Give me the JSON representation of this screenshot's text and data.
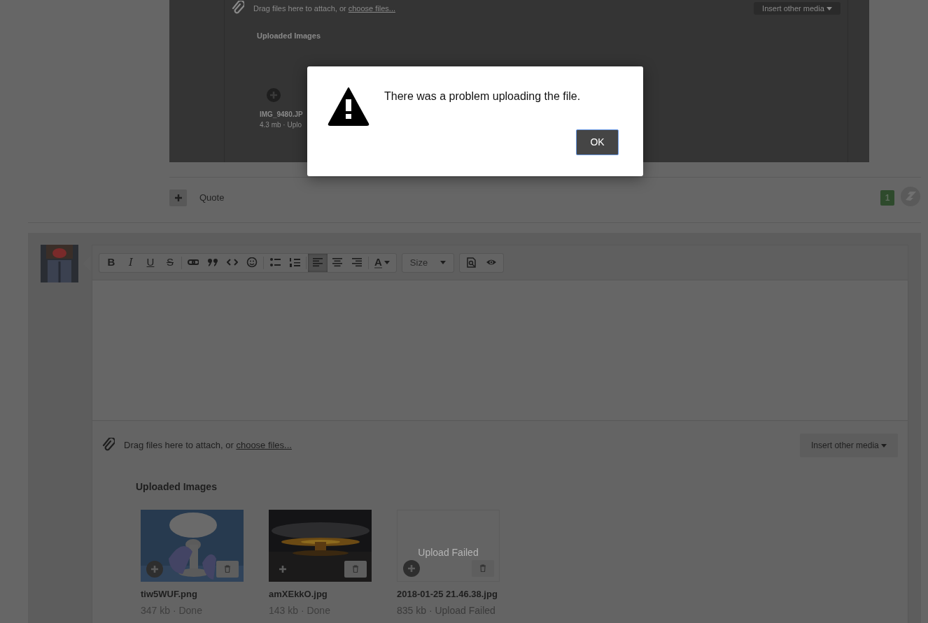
{
  "top_post": {
    "attach": {
      "hint": "Drag files here to attach, or ",
      "link": "choose files..."
    },
    "insert_button": "Insert other media",
    "heading": "Uploaded Images",
    "files": [
      {
        "name": "IMG_9480.JP",
        "meta": "4.3 mb · Uplo"
      }
    ]
  },
  "post_footer": {
    "quote_label": "Quote",
    "count": "1"
  },
  "editor": {
    "toolbar": [
      [
        {
          "kind": "bold",
          "label": "B",
          "selected": false
        },
        {
          "kind": "italic",
          "label": "I",
          "selected": false
        },
        {
          "kind": "underline",
          "label": "U",
          "selected": false
        },
        {
          "kind": "strike",
          "label": "S",
          "selected": false
        },
        {
          "kind": "sep"
        },
        {
          "kind": "link",
          "selected": false
        },
        {
          "kind": "quote",
          "selected": false
        },
        {
          "kind": "code",
          "selected": false
        },
        {
          "kind": "smilie",
          "selected": false
        },
        {
          "kind": "sep"
        },
        {
          "kind": "bullets",
          "selected": false
        },
        {
          "kind": "numbers",
          "selected": false
        },
        {
          "kind": "sep"
        },
        {
          "kind": "align-left",
          "selected": true
        },
        {
          "kind": "align-center",
          "selected": false
        },
        {
          "kind": "align-right",
          "selected": false
        },
        {
          "kind": "sep"
        },
        {
          "kind": "color-menu",
          "label": "A",
          "selected": false
        }
      ],
      [
        {
          "kind": "size-menu",
          "label": "Size",
          "selected": false
        }
      ],
      [
        {
          "kind": "preview",
          "selected": false
        },
        {
          "kind": "eye",
          "selected": false
        }
      ]
    ],
    "attach": {
      "hint": "Drag files here to attach, or ",
      "link": "choose files..."
    },
    "insert_button": "Insert other media",
    "heading": "Uploaded Images",
    "files": [
      {
        "name": "tiw5WUF.png",
        "meta": "347 kb · Done"
      },
      {
        "name": "amXEkkO.jpg",
        "meta": "143 kb · Done"
      },
      {
        "name": "2018-01-25 21.46.38.jpg",
        "meta": "835 kb · Upload Failed",
        "overlay_text": "Upload Failed"
      }
    ]
  },
  "dialog": {
    "message": "There was a problem uploading the file.",
    "button": "OK"
  }
}
